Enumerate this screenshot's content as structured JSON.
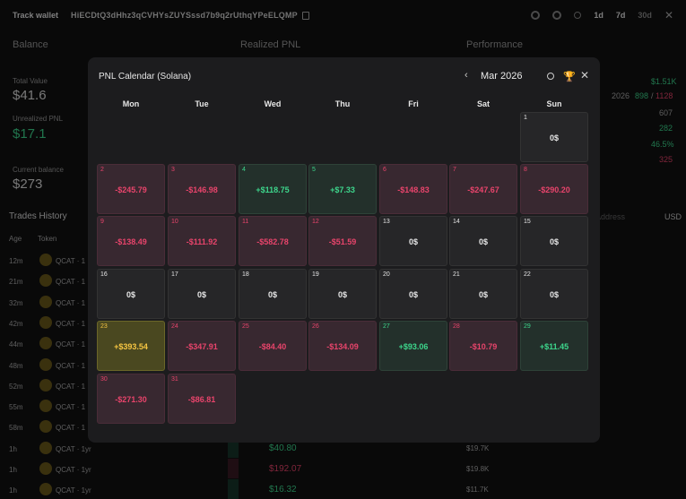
{
  "topbar": {
    "track_label": "Track wallet",
    "address": "HiECDtQ3dHhz3qCVHYsZUYSssd7b9q2rUthqYPeELQMP",
    "range_1d": "1d",
    "range_7d": "7d",
    "range_30d": "30d",
    "close": "✕"
  },
  "background": {
    "balance_title": "Balance",
    "realized_title": "Realized PNL",
    "performance_title": "Performance",
    "total_value_label": "Total Value",
    "total_value": "$41.6",
    "unrealized_label": "Unrealized PNL",
    "unrealized_value": "$17.1",
    "current_balance_label": "Current balance",
    "current_balance": "$273",
    "perf_1": "$1.51K",
    "perf_2a": "2026",
    "perf_2b": "898",
    "perf_2c": "/",
    "perf_2d": "1128",
    "perf_3": "607",
    "perf_4": "282",
    "perf_5": "46.5%",
    "perf_6": "325",
    "trades_history_tab": "Trades History",
    "address_col": "Address",
    "usd_label": "USD",
    "age_header": "Age",
    "token_header": "Token"
  },
  "trades": [
    {
      "age": "12m",
      "token": "QCAT · 1"
    },
    {
      "age": "21m",
      "token": "QCAT · 1"
    },
    {
      "age": "32m",
      "token": "QCAT · 1"
    },
    {
      "age": "42m",
      "token": "QCAT · 1"
    },
    {
      "age": "44m",
      "token": "QCAT · 1"
    },
    {
      "age": "48m",
      "token": "QCAT · 1"
    },
    {
      "age": "52m",
      "token": "QCAT · 1"
    },
    {
      "age": "55m",
      "token": "QCAT · 1"
    },
    {
      "age": "58m",
      "token": "QCAT · 1"
    },
    {
      "age": "1h",
      "token": "QCAT · 1yr",
      "amount": "$40.80",
      "mc": "$19.7K"
    },
    {
      "age": "1h",
      "token": "QCAT · 1yr",
      "amount": "$192.07",
      "mc": "$19.8K"
    },
    {
      "age": "1h",
      "token": "QCAT · 1yr",
      "amount": "$16.32",
      "mc": "$11.7K"
    }
  ],
  "modal": {
    "title": "PNL Calendar (Solana)",
    "month": "Mar 2026",
    "prev": "‹",
    "close": "✕",
    "weekdays": [
      "Mon",
      "Tue",
      "Wed",
      "Thu",
      "Fri",
      "Sat",
      "Sun"
    ],
    "days": [
      {
        "day": "1",
        "value": "0$",
        "kind": "zero"
      },
      {
        "day": "2",
        "value": "-$245.79",
        "kind": "neg"
      },
      {
        "day": "3",
        "value": "-$146.98",
        "kind": "neg"
      },
      {
        "day": "4",
        "value": "+$118.75",
        "kind": "pos"
      },
      {
        "day": "5",
        "value": "+$7.33",
        "kind": "pos"
      },
      {
        "day": "6",
        "value": "-$148.83",
        "kind": "neg"
      },
      {
        "day": "7",
        "value": "-$247.67",
        "kind": "neg"
      },
      {
        "day": "8",
        "value": "-$290.20",
        "kind": "neg"
      },
      {
        "day": "9",
        "value": "-$138.49",
        "kind": "neg"
      },
      {
        "day": "10",
        "value": "-$111.92",
        "kind": "neg"
      },
      {
        "day": "11",
        "value": "-$582.78",
        "kind": "neg"
      },
      {
        "day": "12",
        "value": "-$51.59",
        "kind": "neg"
      },
      {
        "day": "13",
        "value": "0$",
        "kind": "zero"
      },
      {
        "day": "14",
        "value": "0$",
        "kind": "zero"
      },
      {
        "day": "15",
        "value": "0$",
        "kind": "zero"
      },
      {
        "day": "16",
        "value": "0$",
        "kind": "zero"
      },
      {
        "day": "17",
        "value": "0$",
        "kind": "zero"
      },
      {
        "day": "18",
        "value": "0$",
        "kind": "zero"
      },
      {
        "day": "19",
        "value": "0$",
        "kind": "zero"
      },
      {
        "day": "20",
        "value": "0$",
        "kind": "zero"
      },
      {
        "day": "21",
        "value": "0$",
        "kind": "zero"
      },
      {
        "day": "22",
        "value": "0$",
        "kind": "zero"
      },
      {
        "day": "23",
        "value": "+$393.54",
        "kind": "best"
      },
      {
        "day": "24",
        "value": "-$347.91",
        "kind": "neg"
      },
      {
        "day": "25",
        "value": "-$84.40",
        "kind": "neg"
      },
      {
        "day": "26",
        "value": "-$134.09",
        "kind": "neg"
      },
      {
        "day": "27",
        "value": "+$93.06",
        "kind": "pos"
      },
      {
        "day": "28",
        "value": "-$10.79",
        "kind": "neg"
      },
      {
        "day": "29",
        "value": "+$11.45",
        "kind": "pos"
      },
      {
        "day": "30",
        "value": "-$271.30",
        "kind": "neg"
      },
      {
        "day": "31",
        "value": "-$86.81",
        "kind": "neg"
      }
    ]
  }
}
